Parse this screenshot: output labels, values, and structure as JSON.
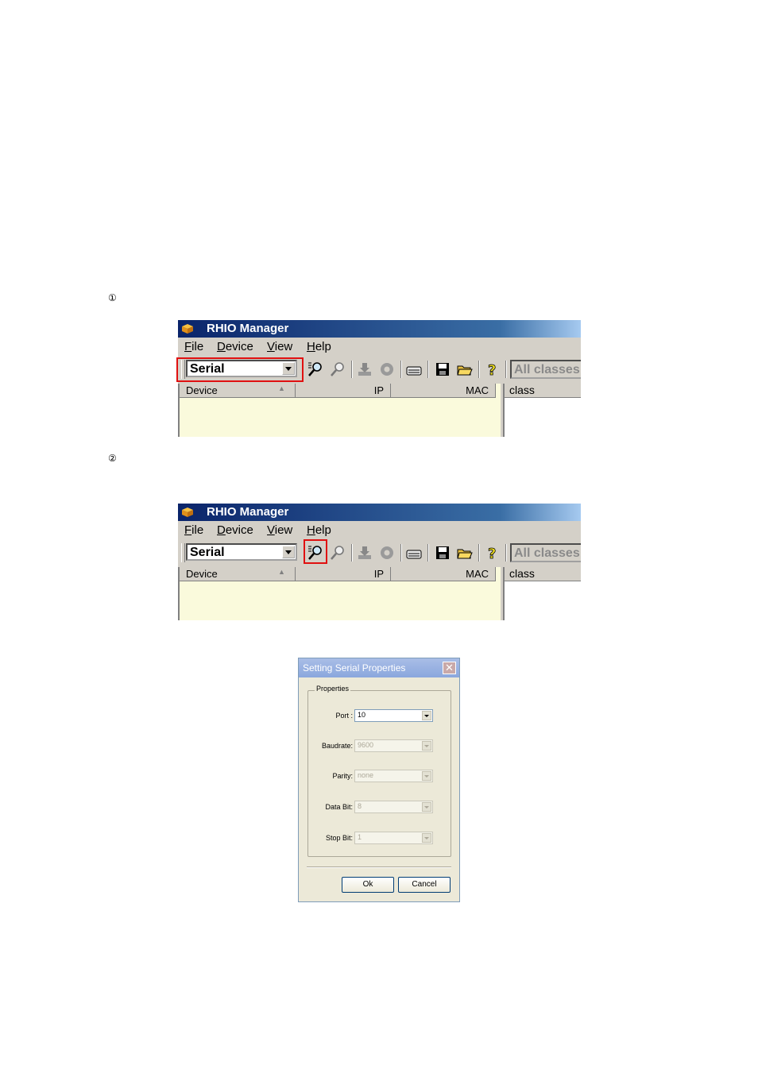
{
  "steps": [
    "①",
    "②"
  ],
  "rhio_window": {
    "title": "RHIO Manager",
    "menu": [
      "File",
      "Device",
      "View",
      "Help"
    ],
    "connection_combo": "Serial",
    "toolbar_icons": [
      "search-device-icon",
      "find-icon",
      "download-icon",
      "refresh-icon",
      "device-icon",
      "save-icon",
      "open-folder-icon",
      "help-icon"
    ],
    "class_filter": "All classes",
    "columns": {
      "device": "Device",
      "ip": "IP",
      "mac": "MAC"
    },
    "class_column": "class"
  },
  "dialog": {
    "title": "Setting Serial Properties",
    "close_label": "✕",
    "group_label": "Properties",
    "fields": [
      {
        "label": "Port :",
        "value": "10",
        "enabled": true
      },
      {
        "label": "Baudrate:",
        "value": "9600",
        "enabled": false
      },
      {
        "label": "Parity:",
        "value": "none",
        "enabled": false
      },
      {
        "label": "Data Bit:",
        "value": "8",
        "enabled": false
      },
      {
        "label": "Stop Bit:",
        "value": "1",
        "enabled": false
      }
    ],
    "ok_label": "Ok",
    "cancel_label": "Cancel"
  },
  "colors": {
    "highlight": "#e01010",
    "titlebar": "#0a246a",
    "list_bg": "#fafadc"
  }
}
